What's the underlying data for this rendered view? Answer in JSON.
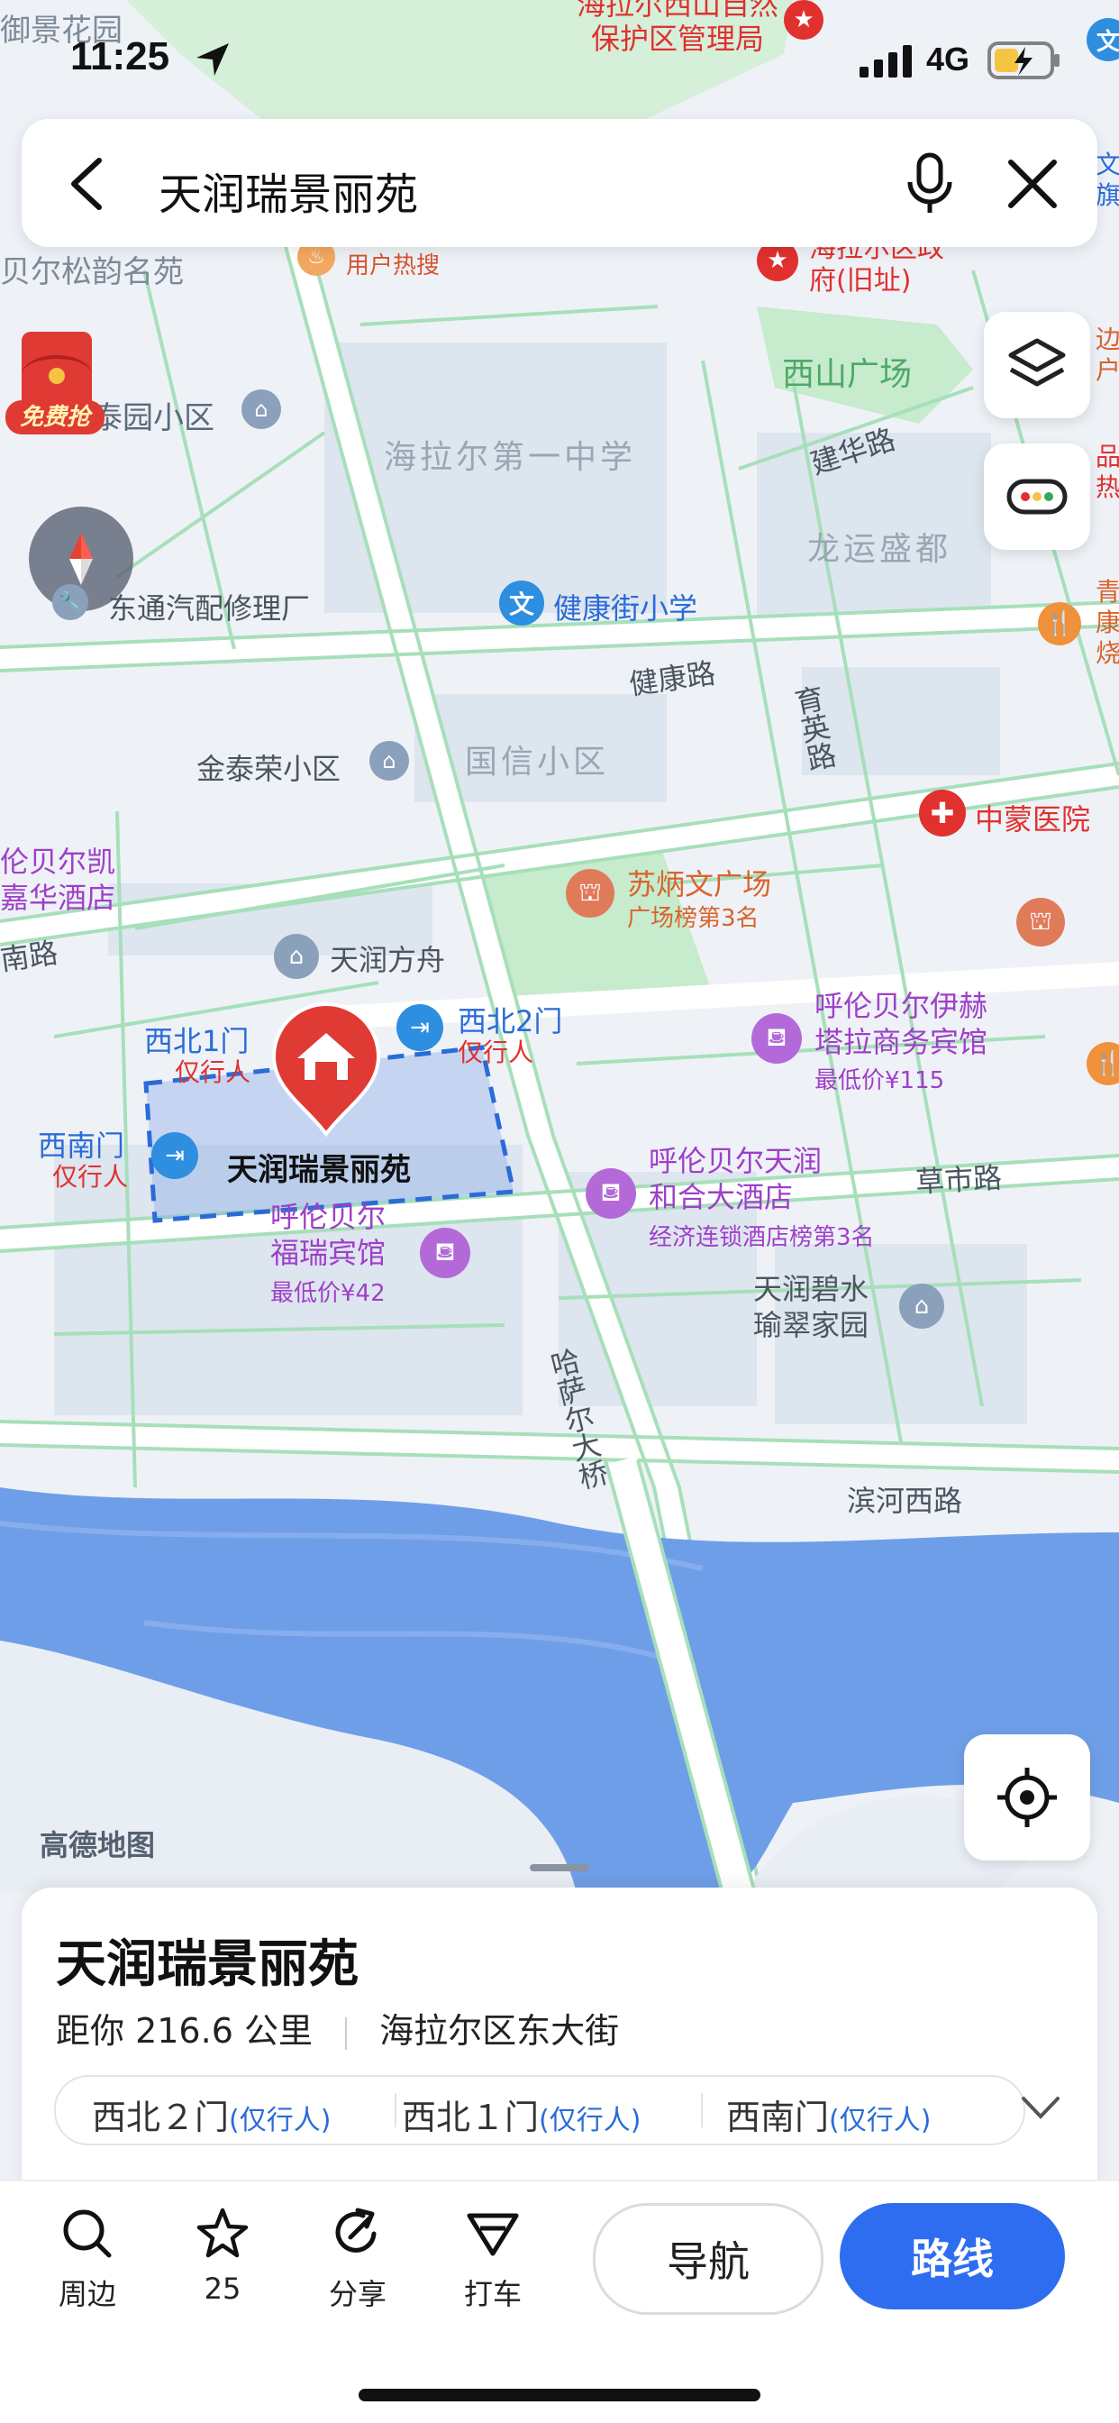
{
  "status_bar": {
    "time": "11:25",
    "network": "4G"
  },
  "search": {
    "query": "天润瑞景丽苑"
  },
  "map": {
    "top_labels": {
      "reserve": "海拉尔西山自然\n保护区管理局",
      "top_left": "御景花园",
      "songyun": "贝尔松韵名苑",
      "hot": "用户热搜",
      "old_gov": "海拉尔区政\n府(旧址)"
    },
    "places": {
      "xishan_square": "西山广场",
      "no1_school": "海拉尔第一中学",
      "taiyuan": "泰园小区",
      "jianhua_road": "建华路",
      "longyun": "龙运盛都",
      "dongtong": "东通汽配修理厂",
      "jiankangjie_school": "健康街小学",
      "jiankang_road": "健康路",
      "yuying_road": "育英路",
      "jintairong": "金泰荣小区",
      "guoxin": "国信小区",
      "zhongmeng": "中蒙医院",
      "kaijia": "伦贝尔凯\n嘉华酒店",
      "nan_road": "南路",
      "subingwen": "苏炳文广场",
      "subingwen_rank": "广场榜第3名",
      "tianrun_fangzhou": "天润方舟",
      "yiheta": "呼伦贝尔伊赫\n塔拉商务宾馆",
      "yiheta_price": "最低价¥115",
      "gate_nw1": "西北1门",
      "gate_nw2": "西北2门",
      "pedestrian": "仅行人",
      "gate_sw": "西南门",
      "target": "天润瑞景丽苑",
      "furui": "呼伦贝尔\n福瑞宾馆",
      "furui_price": "最低价¥42",
      "tianrun_hotel": "呼伦贝尔天润\n和合大酒店",
      "tianrun_hotel_rank": "经济连锁酒店榜第3名",
      "caoshi_road": "草市路",
      "bishui": "天润碧水\n瑜翠家园",
      "hasar_bridge": "哈萨尔大桥",
      "binhe_road": "滨河西路",
      "right_edge_1": "边\n户",
      "right_edge_2": "品\n热",
      "right_edge_3": "青\n康\n烧",
      "right_edge_top": "文\n旗"
    },
    "logo": "高德地图",
    "red_packet": "免费抢"
  },
  "sheet": {
    "title": "天润瑞景丽苑",
    "distance": "距你 216.6 公里",
    "address": "海拉尔区东大街",
    "gates": [
      {
        "name": "西北２门",
        "tag": "(仅行人)"
      },
      {
        "name": "西北１门",
        "tag": "(仅行人)"
      },
      {
        "name": "西南门",
        "tag": "(仅行人)"
      }
    ]
  },
  "toolbar": {
    "nearby": "周边",
    "fav_count": "25",
    "share": "分享",
    "taxi": "打车",
    "navigate": "导航",
    "route": "路线"
  },
  "colors": {
    "accent": "#2f6df0",
    "poi_red": "#e0312f",
    "hotel_purple": "#9f3fc9",
    "water": "#6f9ee8",
    "road_line": "#9fddb5"
  }
}
